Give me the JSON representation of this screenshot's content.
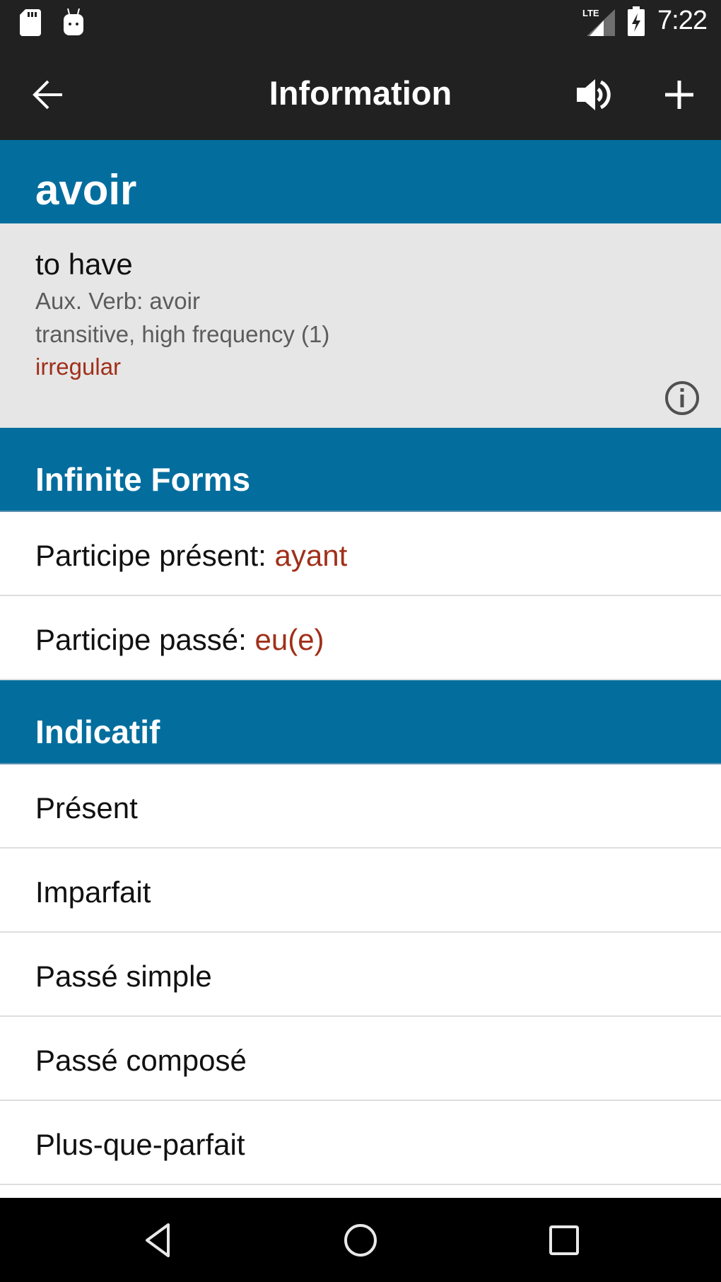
{
  "status_bar": {
    "time": "7:22",
    "left_icons": [
      "sd-card-icon",
      "android-icon"
    ],
    "right_icons": [
      "lte-signal-icon",
      "battery-charging-icon"
    ],
    "network_label": "LTE"
  },
  "toolbar": {
    "title": "Information",
    "back_icon": "arrow-back-icon",
    "speaker_icon": "speaker-icon",
    "add_icon": "plus-icon"
  },
  "verb": {
    "word": "avoir",
    "translation": "to have",
    "aux_verb": "Aux. Verb: avoir",
    "properties": "transitive, high frequency (1)",
    "regularity": "irregular",
    "info_icon": "info-icon"
  },
  "sections": [
    {
      "title": "Infinite Forms",
      "rows": [
        {
          "label": "Participe présent: ",
          "value": "ayant"
        },
        {
          "label": "Participe passé: ",
          "value": "eu(e)"
        }
      ]
    },
    {
      "title": "Indicatif",
      "rows": [
        {
          "label": "Présent",
          "highlighted": true
        },
        {
          "label": "Imparfait",
          "highlighted": false
        },
        {
          "label": "Passé simple",
          "highlighted": true
        },
        {
          "label": "Passé composé",
          "highlighted": false
        },
        {
          "label": "Plus-que-parfait",
          "highlighted": false
        }
      ]
    }
  ],
  "colors": {
    "toolbar_bg": "#212121",
    "header_blue": "#036e9e",
    "card_gray": "#e6e6e6",
    "accent_red": "#a0301a"
  },
  "nav_bar": {
    "icons": [
      "back-triangle-icon",
      "home-circle-icon",
      "recents-square-icon"
    ]
  }
}
